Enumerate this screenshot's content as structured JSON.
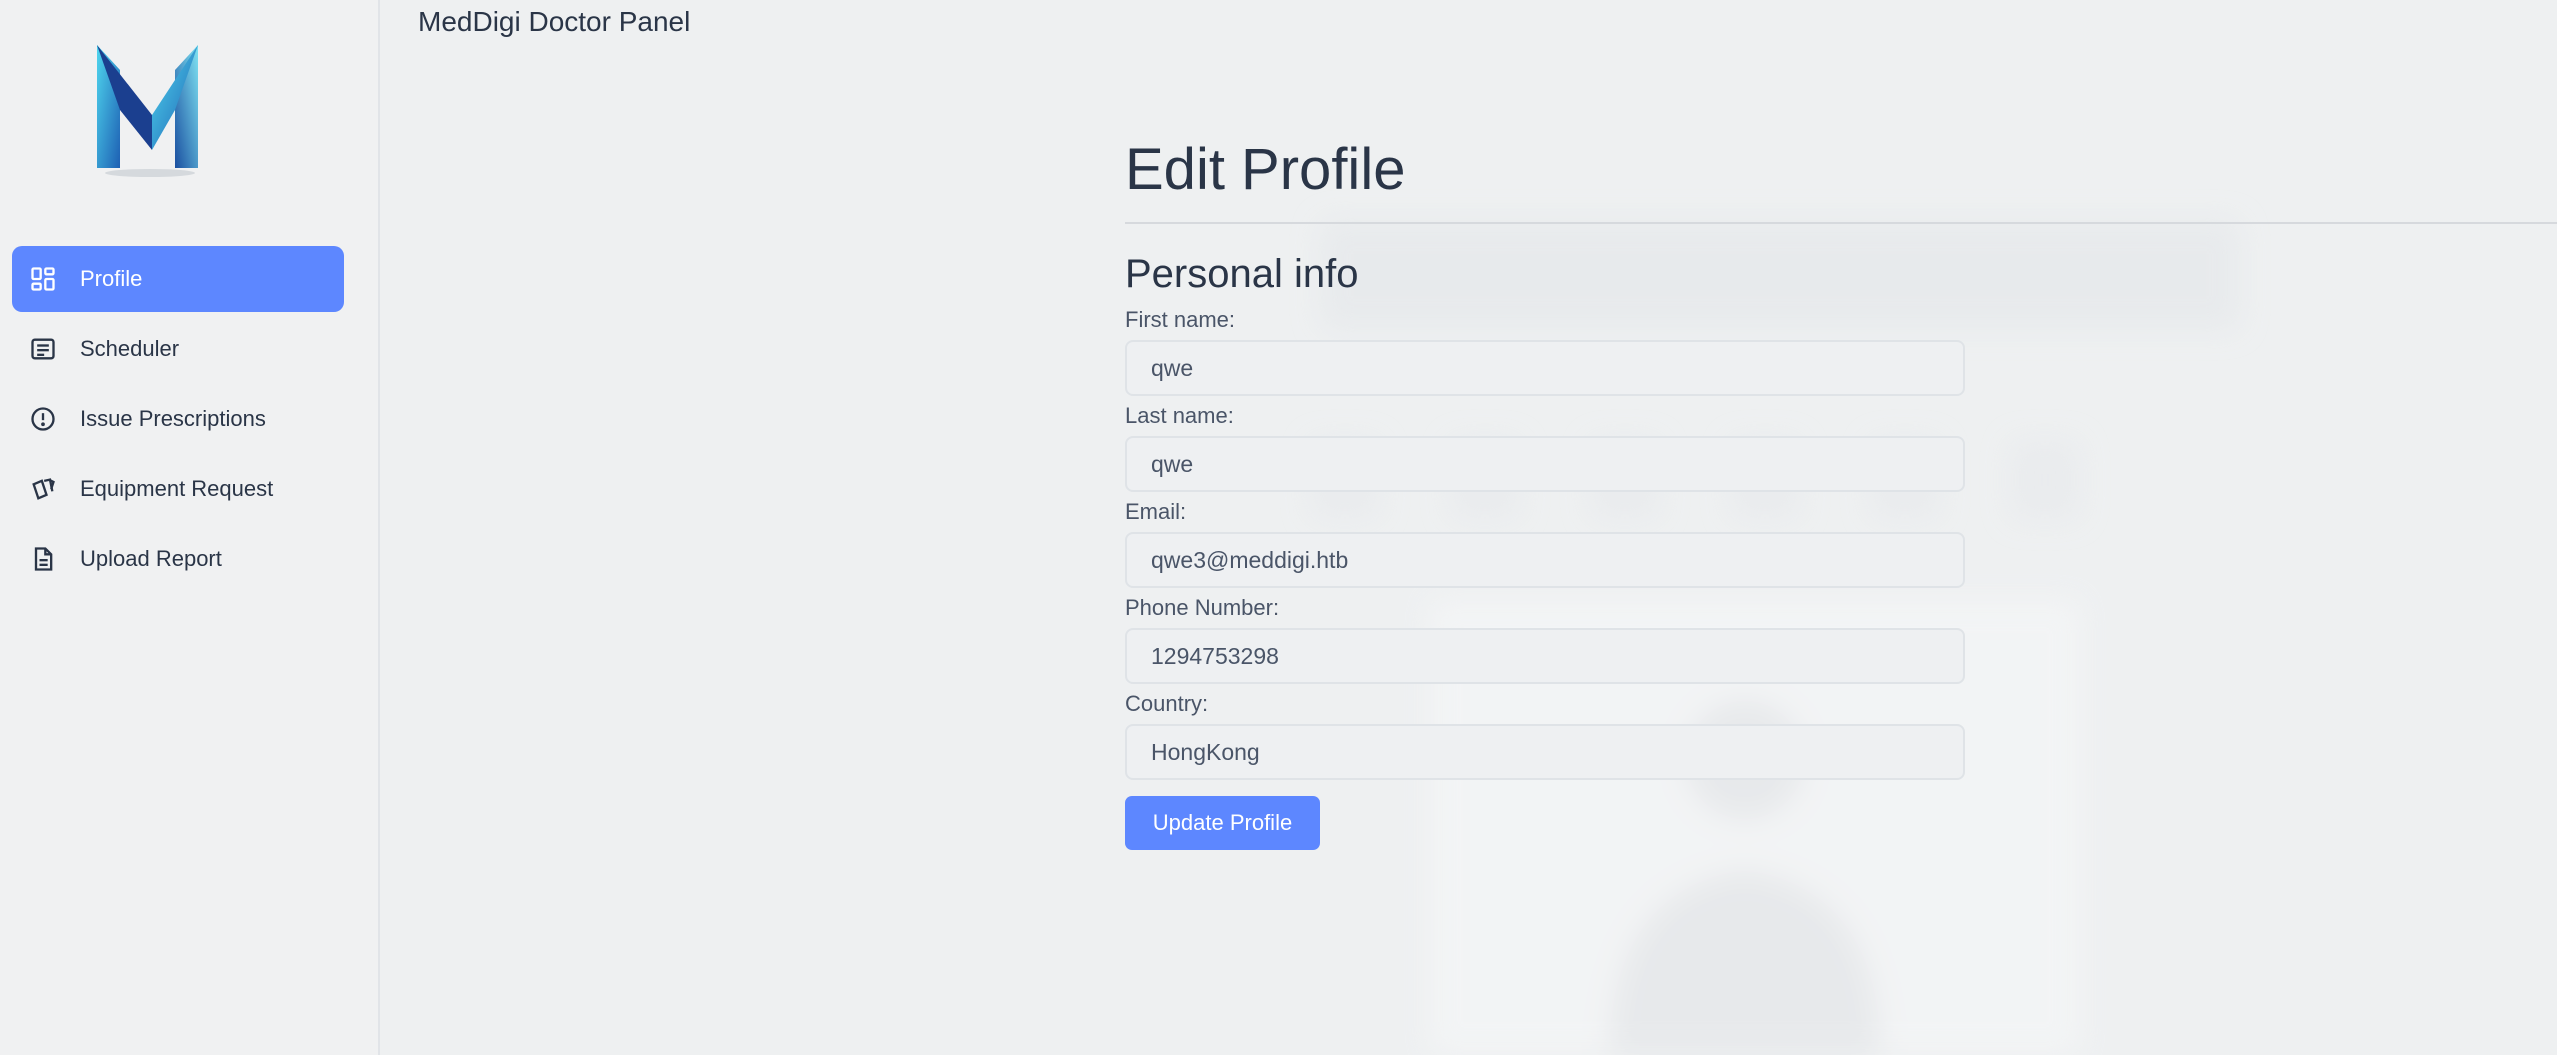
{
  "app": {
    "title": "MedDigi Doctor Panel"
  },
  "sidebar": {
    "items": [
      {
        "label": "Profile",
        "icon": "dashboard-icon",
        "active": true
      },
      {
        "label": "Scheduler",
        "icon": "list-icon",
        "active": false
      },
      {
        "label": "Issue Prescriptions",
        "icon": "alert-circle-icon",
        "active": false
      },
      {
        "label": "Equipment Request",
        "icon": "cards-icon",
        "active": false
      },
      {
        "label": "Upload Report",
        "icon": "document-icon",
        "active": false
      }
    ]
  },
  "main": {
    "title": "Edit Profile",
    "section_title": "Personal info",
    "fields": {
      "first_name": {
        "label": "First name:",
        "value": "qwe"
      },
      "last_name": {
        "label": "Last name:",
        "value": "qwe"
      },
      "email": {
        "label": "Email:",
        "value": "qwe3@meddigi.htb"
      },
      "phone": {
        "label": "Phone Number:",
        "value": "1294753298"
      },
      "country": {
        "label": "Country:",
        "value": "HongKong"
      }
    },
    "update_label": "Update Profile"
  },
  "colors": {
    "accent": "#5d87ff",
    "background": "#eef0f1",
    "sidebar_bg": "#f0f1f2",
    "text": "#2a3547"
  }
}
